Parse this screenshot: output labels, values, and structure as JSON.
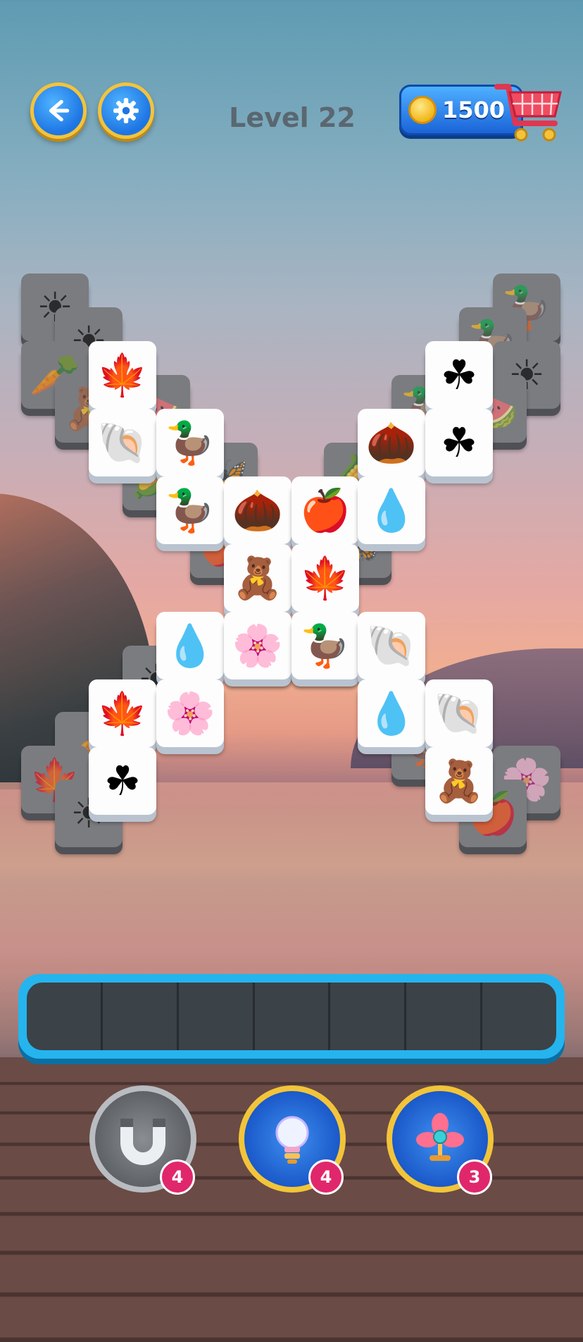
{
  "header": {
    "level_title": "Level 22",
    "coins": "1500"
  },
  "icons": {
    "sun": "☀",
    "duck": "🦆",
    "leaf": "🍁",
    "shell": "🐚",
    "clover": "☘",
    "acorn": "🌰",
    "apple": "🍎",
    "drop": "💧",
    "bear": "🧸",
    "flower": "🌸",
    "watermelon": "🍉",
    "carrot": "🥕",
    "corn": "🌽",
    "butterfly": "🦋"
  },
  "board": {
    "under_tiles": [
      {
        "name": "sun-tile",
        "icon": "sun"
      },
      {
        "name": "sun-tile",
        "icon": "sun"
      },
      {
        "name": "carrot-tile",
        "icon": "carrot"
      },
      {
        "name": "bear-tile",
        "icon": "bear"
      },
      {
        "name": "watermelon-tile",
        "icon": "watermelon"
      },
      {
        "name": "corn-tile",
        "icon": "corn"
      },
      {
        "name": "butterfly-tile",
        "icon": "butterfly"
      },
      {
        "name": "duck-tile",
        "icon": "duck"
      },
      {
        "name": "duck-tile",
        "icon": "duck"
      },
      {
        "name": "sun-tile",
        "icon": "sun"
      },
      {
        "name": "duck-tile",
        "icon": "duck"
      },
      {
        "name": "watermelon-tile",
        "icon": "watermelon"
      },
      {
        "name": "corn-tile",
        "icon": "corn"
      },
      {
        "name": "apple-tile",
        "icon": "apple"
      },
      {
        "name": "butterfly-tile",
        "icon": "butterfly"
      },
      {
        "name": "apple-tile",
        "icon": "apple"
      },
      {
        "name": "shell-tile",
        "icon": "shell"
      },
      {
        "name": "carrot-tile",
        "icon": "carrot"
      },
      {
        "name": "leaf-tile",
        "icon": "leaf"
      },
      {
        "name": "sun-tile",
        "icon": "sun"
      },
      {
        "name": "duck-tile",
        "icon": "duck"
      },
      {
        "name": "flower-tile",
        "icon": "flower"
      },
      {
        "name": "apple-tile",
        "icon": "apple"
      },
      {
        "name": "sun-tile",
        "icon": "sun"
      }
    ],
    "top_tiles": [
      {
        "name": "leaf-tile",
        "icon": "leaf"
      },
      {
        "name": "clover-tile",
        "icon": "clover"
      },
      {
        "name": "shell-tile",
        "icon": "shell"
      },
      {
        "name": "duck-tile",
        "icon": "duck"
      },
      {
        "name": "acorn-tile",
        "icon": "acorn"
      },
      {
        "name": "clover-tile",
        "icon": "clover"
      },
      {
        "name": "duck-tile",
        "icon": "duck"
      },
      {
        "name": "acorn-tile",
        "icon": "acorn"
      },
      {
        "name": "apple-tile",
        "icon": "apple"
      },
      {
        "name": "drop-tile",
        "icon": "drop"
      },
      {
        "name": "bear-tile",
        "icon": "bear"
      },
      {
        "name": "leaf-tile",
        "icon": "leaf"
      },
      {
        "name": "drop-tile",
        "icon": "drop"
      },
      {
        "name": "flower-tile",
        "icon": "flower"
      },
      {
        "name": "duck-tile",
        "icon": "duck"
      },
      {
        "name": "shell-tile",
        "icon": "shell"
      },
      {
        "name": "leaf-tile",
        "icon": "leaf"
      },
      {
        "name": "flower-tile",
        "icon": "flower"
      },
      {
        "name": "drop-tile",
        "icon": "drop"
      },
      {
        "name": "shell-tile",
        "icon": "shell"
      },
      {
        "name": "clover-tile",
        "icon": "clover"
      },
      {
        "name": "bear-tile",
        "icon": "bear"
      }
    ]
  },
  "tray": {
    "slots": 7
  },
  "powerups": {
    "magnet_count": "4",
    "hint_count": "4",
    "shuffle_count": "3"
  }
}
